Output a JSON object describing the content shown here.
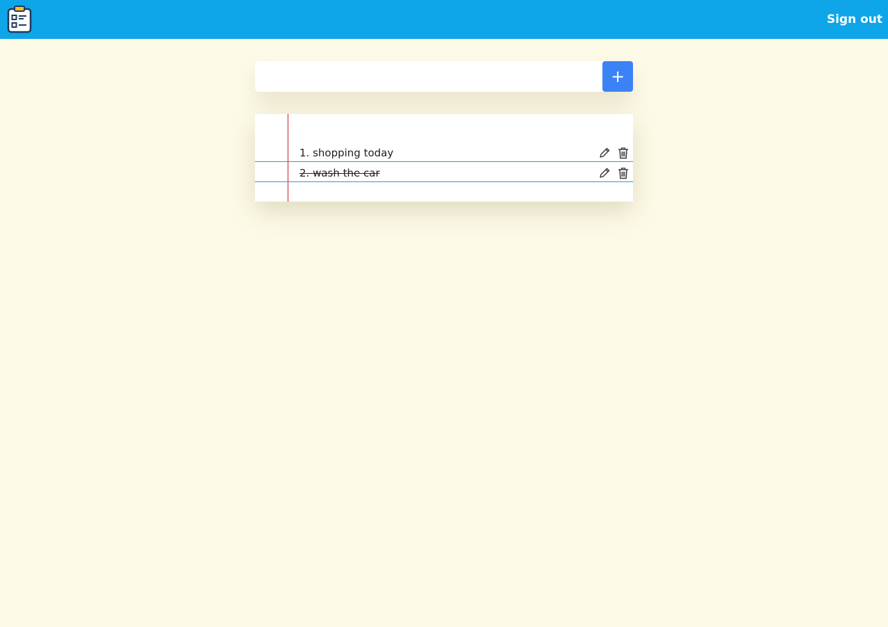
{
  "header": {
    "logo_icon": "clipboard-list-icon",
    "signout_label": "Sign out",
    "bar_color": "#0ea5e9"
  },
  "add_form": {
    "input_value": "",
    "placeholder": "",
    "add_button_label": "+",
    "add_button_color": "#3b82f6"
  },
  "todos": [
    {
      "text": "1. shopping today",
      "completed": false,
      "edit_icon": "pencil-icon",
      "delete_icon": "trash-icon"
    },
    {
      "text": "2. wash the car",
      "completed": true,
      "edit_icon": "pencil-icon",
      "delete_icon": "trash-icon"
    }
  ],
  "colors": {
    "page_background": "#fdfae8",
    "paper_rule_line": "#0ea5e9",
    "paper_margin_line": "#c81e1e"
  }
}
